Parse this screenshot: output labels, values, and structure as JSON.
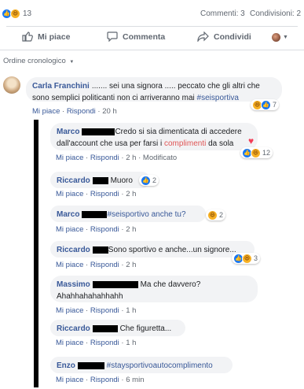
{
  "summary": {
    "reaction_count": "13",
    "comments": "Commenti: 3",
    "shares": "Condivisioni: 2"
  },
  "actions": {
    "like": "Mi piace",
    "comment": "Commenta",
    "share": "Condividi"
  },
  "order": {
    "label": "Ordine cronologico"
  },
  "main_comment": {
    "author": "Carla Franchini",
    "text": "....... sei una signora ..... peccato che gli altri che sono semplici politicanti non ci arriveranno mai ",
    "hashtag": "#seisportiva",
    "like": "Mi piace",
    "reply": "Rispondi",
    "time": "20 h",
    "reactions": "7"
  },
  "replies": [
    {
      "author": "Marco",
      "text_a": "Credo si sia dimenticata di accedere dall'account che usa per farsi i ",
      "highlight": "complimenti",
      "text_b": " da sola",
      "like": "Mi piace",
      "reply": "Rispondi",
      "time": "2 h",
      "extra": "Modificato",
      "reactions": "12"
    },
    {
      "author": "Riccardo",
      "text": "Muoro",
      "like": "Mi piace",
      "reply": "Rispondi",
      "time": "2 h",
      "reactions": "2"
    },
    {
      "author": "Marco",
      "text": "#seisportivo anche tu?",
      "like": "Mi piace",
      "reply": "Rispondi",
      "time": "2 h",
      "reactions": "2"
    },
    {
      "author": "Riccardo",
      "text": "Sono sportivo e anche...un signore...",
      "like": "Mi piace",
      "reply": "Rispondi",
      "time": "2 h",
      "reactions": "3"
    },
    {
      "author": "Massimo",
      "text": "Ma che davvero? Ahahhahahahhahh",
      "like": "Mi piace",
      "reply": "Rispondi",
      "time": "1 h"
    },
    {
      "author": "Riccardo",
      "text": "Che figuretta...",
      "like": "Mi piace",
      "reply": "Rispondi",
      "time": "1 h"
    },
    {
      "author": "Enzo",
      "text": "#staysportivoautocomplimento",
      "like": "Mi piace",
      "reply": "Rispondi",
      "time": "6 min"
    }
  ],
  "colors": {
    "link": "#385898",
    "bubble": "#f2f3f5",
    "like": "#1877f2",
    "love": "#f33e58",
    "haha": "#f7b125"
  }
}
